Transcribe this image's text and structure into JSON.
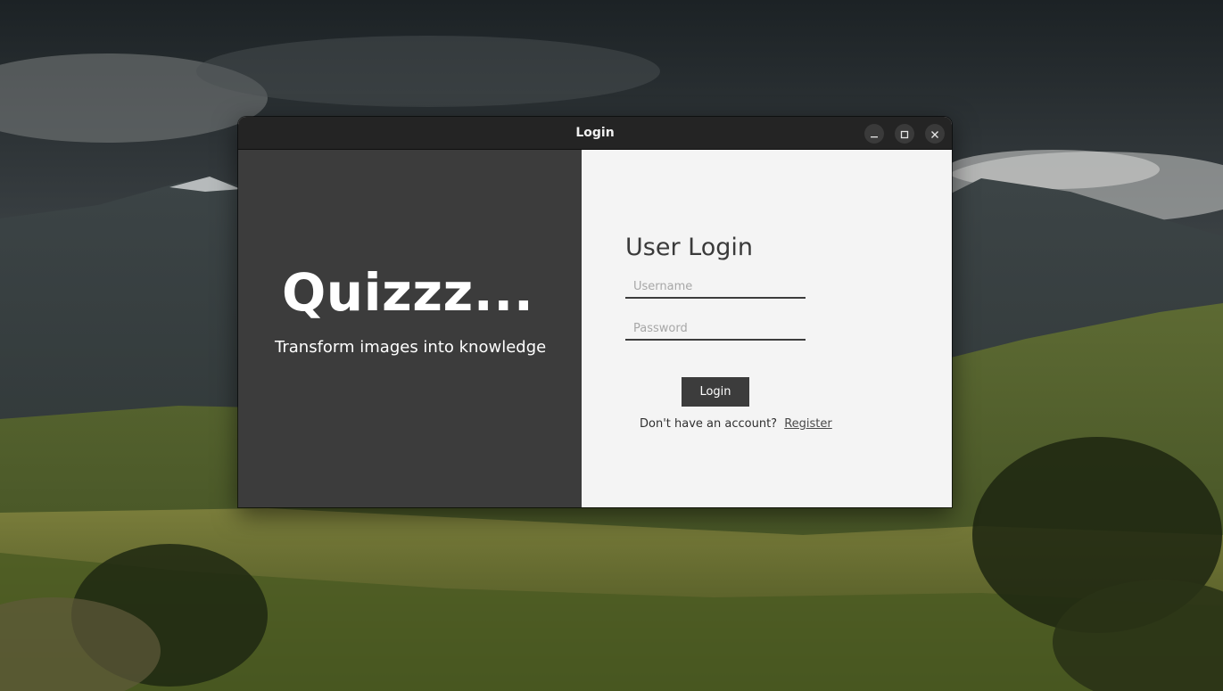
{
  "window": {
    "title": "Login",
    "controls": {
      "minimize": "minimize-icon",
      "maximize": "maximize-icon",
      "close": "close-icon"
    }
  },
  "brand": {
    "name": "Quizzz...",
    "tagline": "Transform images into knowledge"
  },
  "login": {
    "heading": "User Login",
    "username_placeholder": "Username",
    "password_placeholder": "Password",
    "button_label": "Login",
    "prompt": "Don't have an account?",
    "register_label": "Register"
  },
  "colors": {
    "left_panel": "#3c3c3c",
    "right_panel": "#f4f4f4",
    "titlebar": "#242424",
    "accent": "#3c3c3c"
  }
}
